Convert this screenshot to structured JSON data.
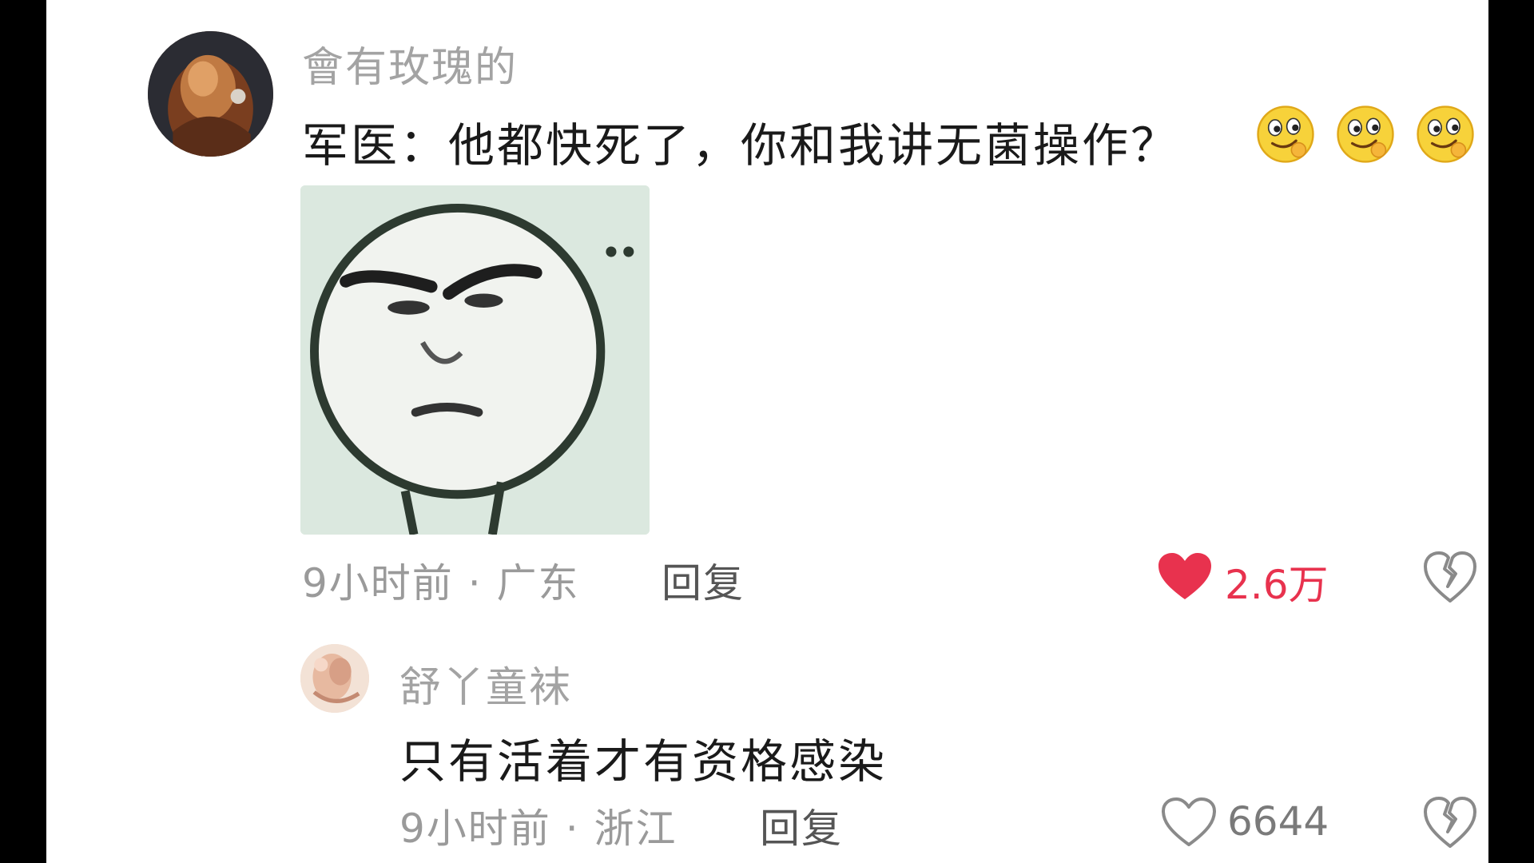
{
  "thread": {
    "main_comment": {
      "username": "會有玫瑰的",
      "avatar": "user-avatar-photo",
      "text": "军医：他都快死了，你和我讲无菌操作？",
      "emojis": [
        "smirk-face-icon",
        "smirk-face-icon",
        "smirk-face-icon"
      ],
      "sticker": "meme-face-sticker",
      "time": "9小时前",
      "location": "广东",
      "meta_separator": " · ",
      "reply_label": "回复",
      "like_count": "2.6万",
      "liked": true
    },
    "reply_comment": {
      "username": "舒丫童袜",
      "avatar": "user-avatar-photo",
      "text": "只有活着才有资格感染",
      "time": "9小时前",
      "location": "浙江",
      "meta_separator": " · ",
      "reply_label": "回复",
      "like_count": "6644",
      "liked": false
    }
  },
  "colors": {
    "liked_red": "#e8324e",
    "username_gray": "#a3a3a3",
    "text_dark": "#1a1a1a",
    "meta_gray": "#9a9a9a"
  }
}
